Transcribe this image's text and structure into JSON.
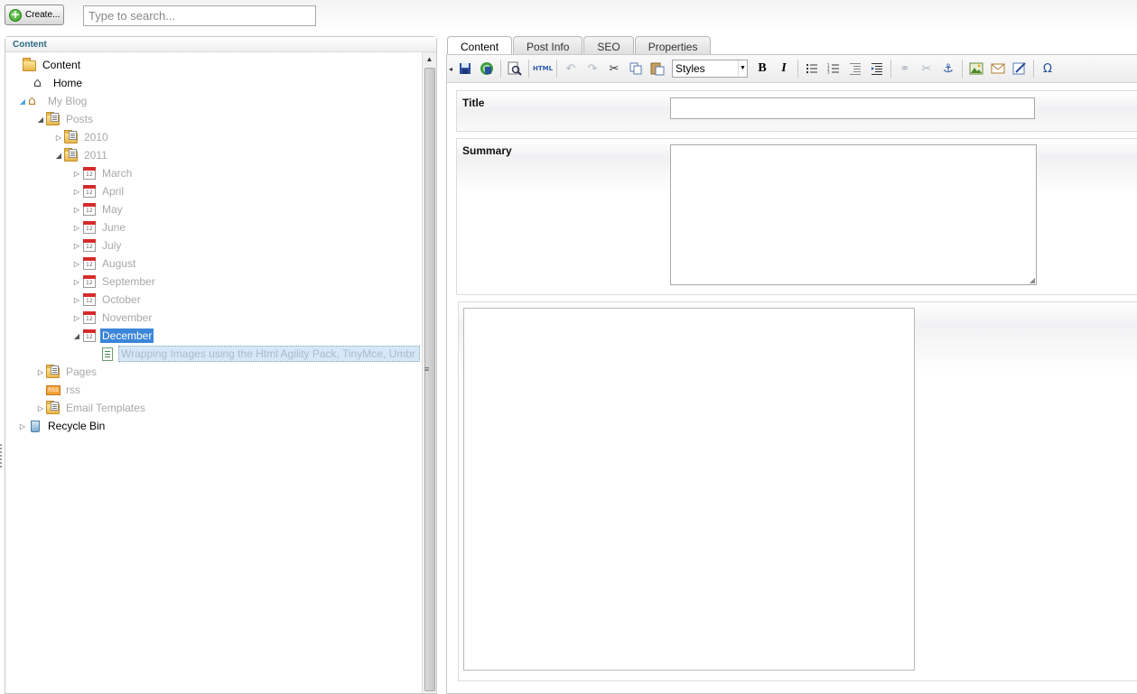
{
  "topbar": {
    "create_label": "Create...",
    "search_placeholder": "Type to search..."
  },
  "tree": {
    "header": "Content",
    "nodes": [
      {
        "label": "Content",
        "icon": "folder-icon"
      },
      {
        "label": "Home",
        "icon": "house-icon"
      },
      {
        "label": "My Blog",
        "icon": "house-icon"
      },
      {
        "label": "Posts",
        "icon": "folder-icon"
      },
      {
        "label": "2010",
        "icon": "folder-icon"
      },
      {
        "label": "2011",
        "icon": "folder-icon"
      },
      {
        "label": "March",
        "icon": "calendar-icon"
      },
      {
        "label": "April",
        "icon": "calendar-icon"
      },
      {
        "label": "May",
        "icon": "calendar-icon"
      },
      {
        "label": "June",
        "icon": "calendar-icon"
      },
      {
        "label": "July",
        "icon": "calendar-icon"
      },
      {
        "label": "August",
        "icon": "calendar-icon"
      },
      {
        "label": "September",
        "icon": "calendar-icon"
      },
      {
        "label": "October",
        "icon": "calendar-icon"
      },
      {
        "label": "November",
        "icon": "calendar-icon"
      },
      {
        "label": "December",
        "icon": "calendar-icon"
      },
      {
        "label": "Wrapping Images using the Html Agility Pack, TinyMce, Umbr",
        "icon": "document-icon"
      },
      {
        "label": "Pages",
        "icon": "folder-icon"
      },
      {
        "label": "rss",
        "icon": "rss-icon"
      },
      {
        "label": "Email Templates",
        "icon": "folder-icon"
      },
      {
        "label": "Recycle Bin",
        "icon": "recycle-bin-icon"
      }
    ]
  },
  "tabs": [
    "Content",
    "Post Info",
    "SEO",
    "Properties"
  ],
  "toolbar": {
    "html_label": "HTML",
    "styles_value": "Styles",
    "bold_label": "B",
    "italic_label": "I",
    "omega_label": "Ω"
  },
  "form": {
    "title_label": "Title",
    "summary_label": "Summary"
  },
  "colors": {
    "selection": "#3b86d9",
    "tree_header": "#2b6a80",
    "toolbar_icon": "#1f4f9a"
  }
}
